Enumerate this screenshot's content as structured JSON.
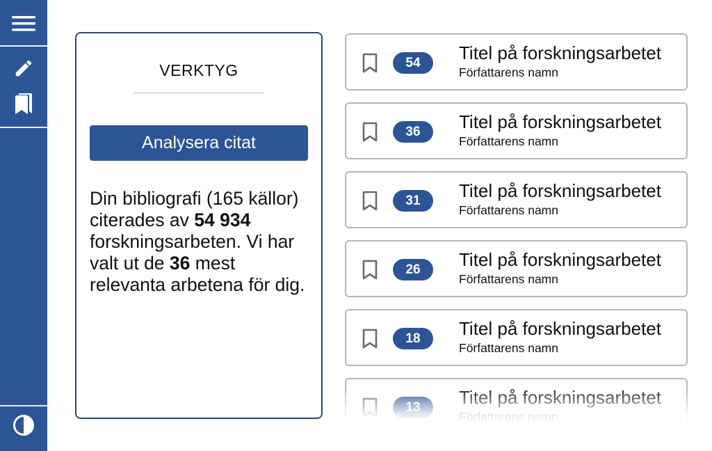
{
  "sidebar": {
    "menu_icon": "hamburger-menu-icon",
    "items": [
      {
        "icon": "pencil-icon"
      },
      {
        "icon": "bookmarks-icon"
      }
    ],
    "bottom_icon": "contrast-icon"
  },
  "tools": {
    "title": "VERKTYG",
    "analyze_button_label": "Analysera citat",
    "summary": {
      "part1": "Din bibliografi (165 källor) citerades av ",
      "cited_count": "54 934",
      "part2": " forskningsarbeten. Vi har valt ut de ",
      "selected_count": "36",
      "part3": " mest relevanta arbetena för dig."
    }
  },
  "results": [
    {
      "score": "54",
      "title": "Titel på forskningsarbetet",
      "author": "Författarens namn"
    },
    {
      "score": "36",
      "title": "Titel på forskningsarbetet",
      "author": "Författarens namn"
    },
    {
      "score": "31",
      "title": "Titel på forskningsarbetet",
      "author": "Författarens namn"
    },
    {
      "score": "26",
      "title": "Titel på forskningsarbetet",
      "author": "Författarens namn"
    },
    {
      "score": "18",
      "title": "Titel på forskningsarbetet",
      "author": "Författarens namn"
    },
    {
      "score": "13",
      "title": "Titel på forskningsarbetet",
      "author": "Författarens namn"
    }
  ],
  "colors": {
    "primary": "#2d5595",
    "panel_border": "#2d4a73",
    "card_border": "#b7b7b7"
  }
}
